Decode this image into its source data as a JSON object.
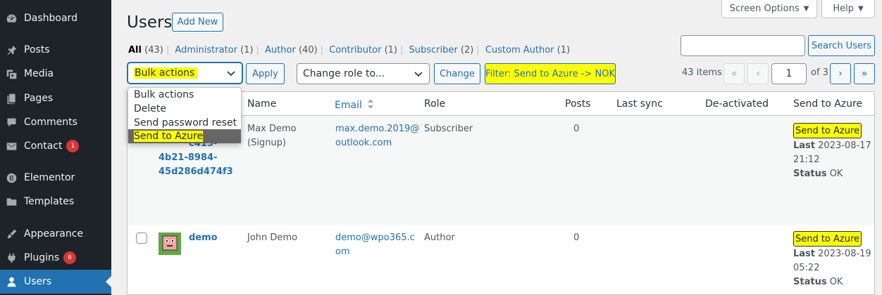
{
  "sidebar": {
    "items": [
      {
        "label": "Dashboard",
        "icon": "dashboard-icon"
      },
      {
        "label": "Posts",
        "icon": "pin-icon"
      },
      {
        "label": "Media",
        "icon": "media-icon"
      },
      {
        "label": "Pages",
        "icon": "pages-icon"
      },
      {
        "label": "Comments",
        "icon": "comment-icon"
      },
      {
        "label": "Contact",
        "icon": "mail-icon",
        "badge": "1"
      },
      {
        "label": "Elementor",
        "icon": "elementor-icon"
      },
      {
        "label": "Templates",
        "icon": "folder-icon"
      },
      {
        "label": "Appearance",
        "icon": "brush-icon"
      },
      {
        "label": "Plugins",
        "icon": "plug-icon",
        "badge": "6"
      },
      {
        "label": "Users",
        "icon": "user-icon"
      }
    ]
  },
  "header": {
    "screen_options": "Screen Options",
    "help": "Help",
    "title": "Users",
    "add_new": "Add New"
  },
  "filters": {
    "all": "All",
    "all_count": "(43)",
    "administrator": "Administrator",
    "administrator_count": "(1)",
    "author": "Author",
    "author_count": "(40)",
    "contributor": "Contributor",
    "contributor_count": "(1)",
    "subscriber": "Subscriber",
    "subscriber_count": "(2)",
    "custom_author": "Custom Author",
    "custom_author_count": "(1)"
  },
  "search": {
    "button": "Search Users",
    "value": ""
  },
  "toolbar": {
    "bulk_selected": "Bulk actions",
    "apply": "Apply",
    "change_role": "Change role to...",
    "change": "Change",
    "filter_azure": "Filter: Send to Azure -> NOK"
  },
  "pagination": {
    "items": "43 items",
    "first": "«",
    "prev": "‹",
    "current": "1",
    "of": "of 3",
    "next": "›",
    "last": "»"
  },
  "dropdown": {
    "options": [
      "Bulk actions",
      "Delete",
      "Send password reset",
      "Send to Azure"
    ],
    "selected": "Send to Azure"
  },
  "table": {
    "columns": {
      "name": "Name",
      "email": "Email",
      "role": "Role",
      "posts": "Posts",
      "last_sync": "Last sync",
      "deactivated": "De-activated",
      "send_to_azure": "Send to Azure"
    },
    "rows": [
      {
        "username_lines": [
          "c415-",
          "4b21-8984-",
          "45d286d474f3"
        ],
        "name_lines": [
          "Max Demo",
          "(Signup)"
        ],
        "email_lines": [
          "max.demo.2019@",
          "outlook.com"
        ],
        "role": "Subscriber",
        "posts": "0",
        "azure_button": "Send to Azure",
        "last_label": "Last",
        "last_date": "2023-08-17",
        "last_time": "21:12",
        "status_label": "Status",
        "status_value": "OK"
      },
      {
        "username": "demo",
        "name": "John Demo",
        "email_lines": [
          "demo@wpo365.c",
          "om"
        ],
        "role": "Author",
        "posts": "0",
        "azure_button": "Send to Azure",
        "last_label": "Last",
        "last_date": "2023-08-19",
        "last_time": "05:22",
        "status_label": "Status",
        "status_value": "OK"
      }
    ]
  }
}
